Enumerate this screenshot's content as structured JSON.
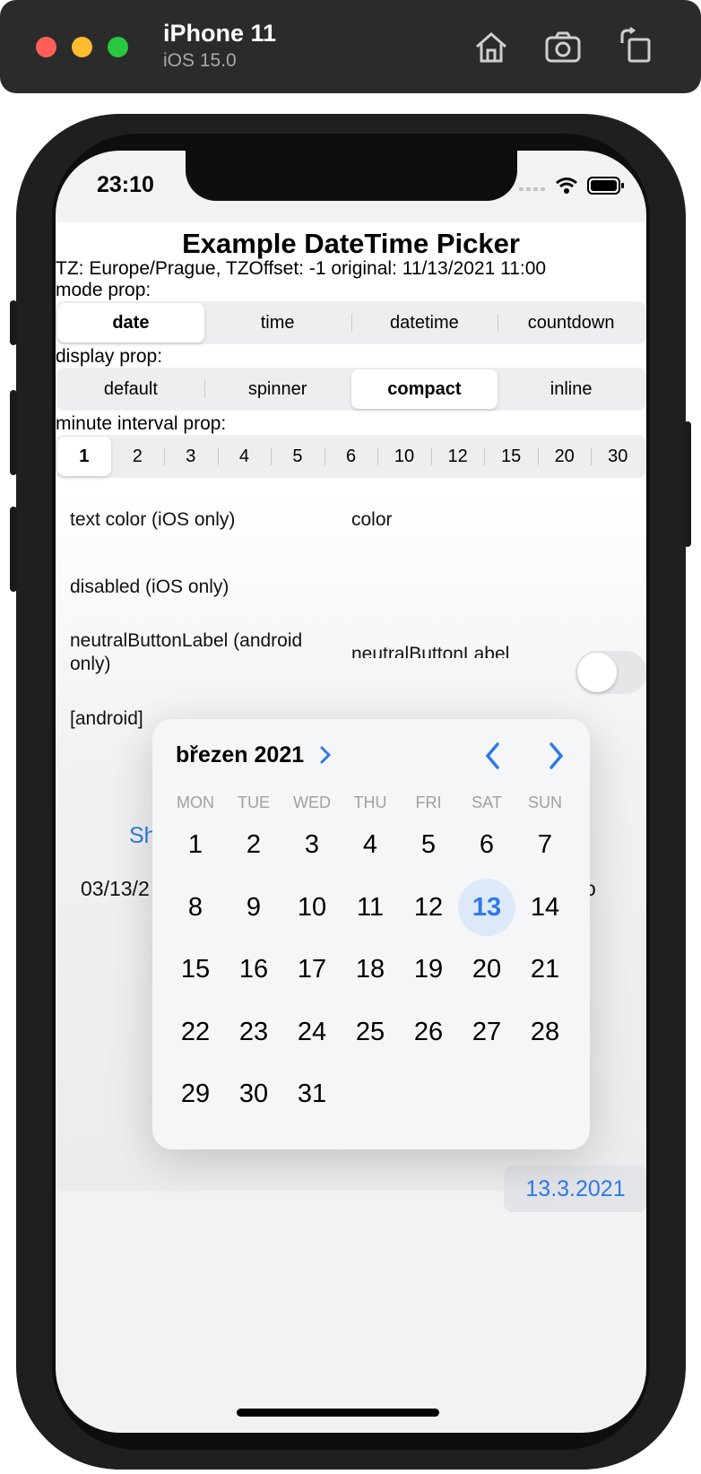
{
  "simulator": {
    "device_name": "iPhone 11",
    "os_version": "iOS 15.0",
    "toolbar_icons": [
      "home-icon",
      "screenshot-icon",
      "rotate-icon"
    ]
  },
  "status_bar": {
    "time": "23:10",
    "icons": [
      "signal-icon",
      "wifi-icon",
      "battery-icon"
    ]
  },
  "app": {
    "title": "Example DateTime Picker",
    "tz_info": "TZ: Europe/Prague, TZOffset: -1 original: 11/13/2021 11:00",
    "mode_label": "mode prop:",
    "mode_options": [
      "date",
      "time",
      "datetime",
      "countdown"
    ],
    "mode_selected": "date",
    "display_label": "display prop:",
    "display_options": [
      "default",
      "spinner",
      "compact",
      "inline"
    ],
    "display_selected": "compact",
    "minute_label": "minute interval prop:",
    "minute_options": [
      "1",
      "2",
      "3",
      "4",
      "5",
      "6",
      "10",
      "12",
      "15",
      "20",
      "30"
    ],
    "minute_selected": "1",
    "text_color_label": "text color (iOS only)",
    "text_color_placeholder": "color",
    "disabled_label": "disabled (iOS only)",
    "disabled_value": false,
    "neutral_label": "neutralButtonLabel (android only)",
    "neutral_placeholder": "neutralButtonLabel",
    "android_label": "[android]",
    "partial_button": "Sh",
    "partial_date": "03/13/2",
    "partial_right": "o",
    "date_chip": "13.3.2021"
  },
  "calendar": {
    "month": "březen 2021",
    "weekdays": [
      "MON",
      "TUE",
      "WED",
      "THU",
      "FRI",
      "SAT",
      "SUN"
    ],
    "days": [
      "1",
      "2",
      "3",
      "4",
      "5",
      "6",
      "7",
      "8",
      "9",
      "10",
      "11",
      "12",
      "13",
      "14",
      "15",
      "16",
      "17",
      "18",
      "19",
      "20",
      "21",
      "22",
      "23",
      "24",
      "25",
      "26",
      "27",
      "28",
      "29",
      "30",
      "31"
    ],
    "selected_day": "13"
  },
  "colors": {
    "accent": "#2f7ae5",
    "selected_day_bg": "#dce9f8"
  }
}
